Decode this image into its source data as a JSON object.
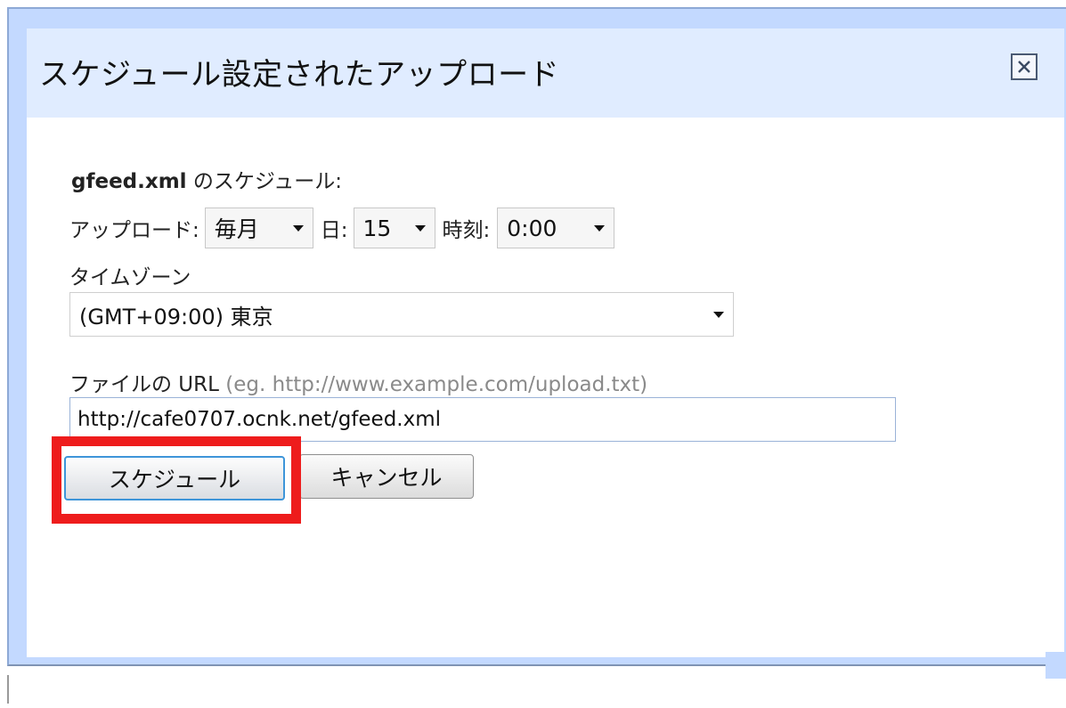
{
  "dialog": {
    "title": "スケジュール設定されたアップロード",
    "close_icon": "close-icon"
  },
  "schedule": {
    "filename": "gfeed.xml",
    "heading_suffix": " のスケジュール:"
  },
  "upload_row": {
    "upload_label": "アップロード:",
    "frequency_value": "毎月",
    "day_label": "日:",
    "day_value": "15",
    "time_label": "時刻:",
    "time_value": "0:00"
  },
  "timezone": {
    "label": "タイムゾーン",
    "value": "(GMT+09:00) 東京"
  },
  "url": {
    "label": "ファイルの URL",
    "hint": "(eg. http://www.example.com/upload.txt)",
    "value": "http://cafe0707.ocnk.net/gfeed.xml"
  },
  "buttons": {
    "schedule_label": "スケジュール",
    "cancel_label": "キャンセル"
  },
  "colors": {
    "highlight": "#ee1c1c",
    "title_bar": "#e0ecff",
    "frame": "#c3d9ff"
  }
}
